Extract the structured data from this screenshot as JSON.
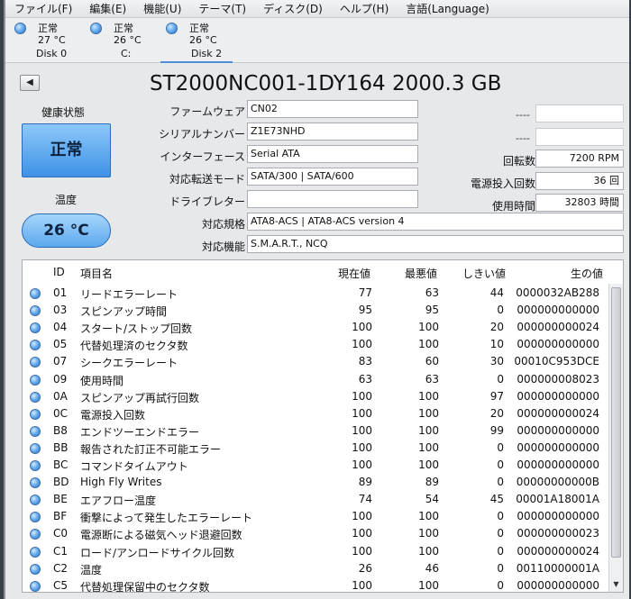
{
  "menu": [
    "ファイル(F)",
    "編集(E)",
    "機能(U)",
    "テーマ(T)",
    "ディスク(D)",
    "ヘルプ(H)",
    "言語(Language)"
  ],
  "disks": [
    {
      "status": "正常",
      "temp": "27 °C",
      "name": "Disk 0"
    },
    {
      "status": "正常",
      "temp": "26 °C",
      "name": "C:"
    },
    {
      "status": "正常",
      "temp": "26 °C",
      "name": "Disk 2"
    }
  ],
  "nav_arrow": "◀",
  "title": "ST2000NC001-1DY164 2000.3 GB",
  "health": {
    "label": "健康状態",
    "value": "正常"
  },
  "temperature": {
    "label": "温度",
    "value": "26 °C"
  },
  "fields": {
    "firmware": {
      "label": "ファームウェア",
      "value": "CN02"
    },
    "serial": {
      "label": "シリアルナンバー",
      "value": "Z1E73NHD"
    },
    "interface": {
      "label": "インターフェース",
      "value": "Serial ATA"
    },
    "transfer": {
      "label": "対応転送モード",
      "value": "SATA/300 | SATA/600"
    },
    "drive_letter": {
      "label": "ドライブレター",
      "value": ""
    },
    "standard": {
      "label": "対応規格",
      "value": "ATA8-ACS | ATA8-ACS version 4"
    },
    "features": {
      "label": "対応機能",
      "value": "S.M.A.R.T., NCQ"
    }
  },
  "right_fields": {
    "dash1": "----",
    "dash2": "----",
    "rpm": {
      "label": "回転数",
      "value": "7200 RPM"
    },
    "power_count": {
      "label": "電源投入回数",
      "value": "36 回"
    },
    "hours": {
      "label": "使用時間",
      "value": "32803 時間"
    }
  },
  "table": {
    "headers": {
      "id": "ID",
      "name": "項目名",
      "current": "現在値",
      "worst": "最悪値",
      "threshold": "しきい値",
      "raw": "生の値"
    },
    "rows": [
      {
        "id": "01",
        "name": "リードエラーレート",
        "current": "77",
        "worst": "63",
        "threshold": "44",
        "raw": "0000032AB288"
      },
      {
        "id": "03",
        "name": "スピンアップ時間",
        "current": "95",
        "worst": "95",
        "threshold": "0",
        "raw": "000000000000"
      },
      {
        "id": "04",
        "name": "スタート/ストップ回数",
        "current": "100",
        "worst": "100",
        "threshold": "20",
        "raw": "000000000024"
      },
      {
        "id": "05",
        "name": "代替処理済のセクタ数",
        "current": "100",
        "worst": "100",
        "threshold": "10",
        "raw": "000000000000"
      },
      {
        "id": "07",
        "name": "シークエラーレート",
        "current": "83",
        "worst": "60",
        "threshold": "30",
        "raw": "00010C953DCE"
      },
      {
        "id": "09",
        "name": "使用時間",
        "current": "63",
        "worst": "63",
        "threshold": "0",
        "raw": "000000008023"
      },
      {
        "id": "0A",
        "name": "スピンアップ再試行回数",
        "current": "100",
        "worst": "100",
        "threshold": "97",
        "raw": "000000000000"
      },
      {
        "id": "0C",
        "name": "電源投入回数",
        "current": "100",
        "worst": "100",
        "threshold": "20",
        "raw": "000000000024"
      },
      {
        "id": "B8",
        "name": "エンドツーエンドエラー",
        "current": "100",
        "worst": "100",
        "threshold": "99",
        "raw": "000000000000"
      },
      {
        "id": "BB",
        "name": "報告された訂正不可能エラー",
        "current": "100",
        "worst": "100",
        "threshold": "0",
        "raw": "000000000000"
      },
      {
        "id": "BC",
        "name": "コマンドタイムアウト",
        "current": "100",
        "worst": "100",
        "threshold": "0",
        "raw": "000000000000"
      },
      {
        "id": "BD",
        "name": "High Fly Writes",
        "current": "89",
        "worst": "89",
        "threshold": "0",
        "raw": "00000000000B"
      },
      {
        "id": "BE",
        "name": "エアフロー温度",
        "current": "74",
        "worst": "54",
        "threshold": "45",
        "raw": "00001A18001A"
      },
      {
        "id": "BF",
        "name": "衝撃によって発生したエラーレート",
        "current": "100",
        "worst": "100",
        "threshold": "0",
        "raw": "000000000000"
      },
      {
        "id": "C0",
        "name": "電源断による磁気ヘッド退避回数",
        "current": "100",
        "worst": "100",
        "threshold": "0",
        "raw": "000000000023"
      },
      {
        "id": "C1",
        "name": "ロード/アンロードサイクル回数",
        "current": "100",
        "worst": "100",
        "threshold": "0",
        "raw": "000000000024"
      },
      {
        "id": "C2",
        "name": "温度",
        "current": "26",
        "worst": "46",
        "threshold": "0",
        "raw": "00110000001A"
      },
      {
        "id": "C5",
        "name": "代替処理保留中のセクタ数",
        "current": "100",
        "worst": "100",
        "threshold": "0",
        "raw": "000000000000"
      }
    ]
  }
}
